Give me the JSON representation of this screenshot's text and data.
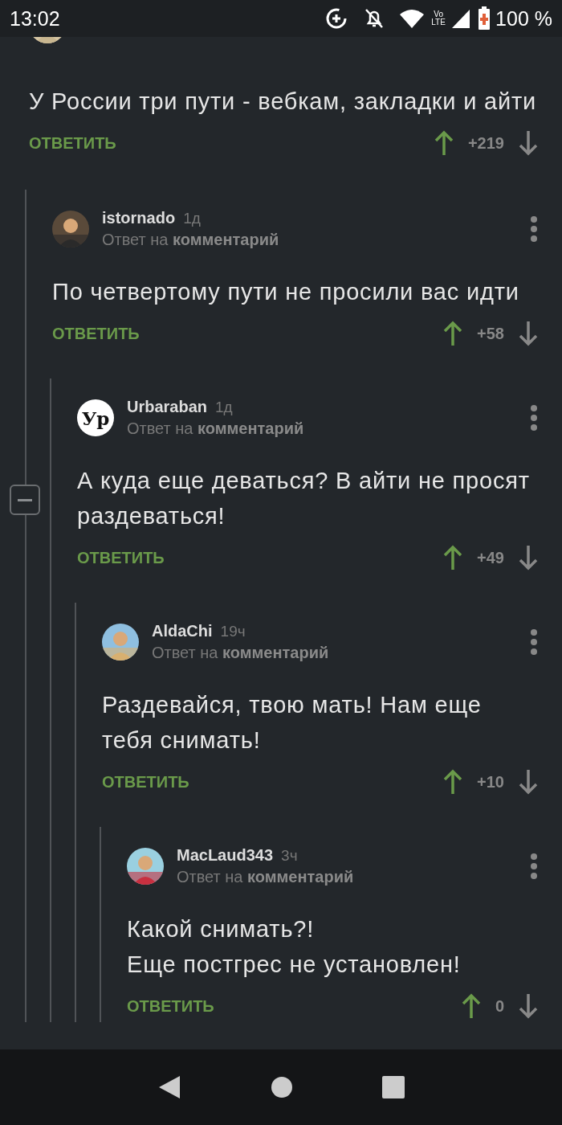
{
  "status_bar": {
    "time": "13:02",
    "network": "Vo LTE",
    "battery": "100 %"
  },
  "comments": [
    {
      "text": "У России три пути - вебкам, закладки и айти",
      "reply": "ОТВЕТИТЬ",
      "score": "+219",
      "children": [
        {
          "author": "istornado",
          "time": "1д",
          "subtitle": "Ответ на **комментарий**",
          "text": "По четвертому пути не просили вас идти",
          "reply": "ОТВЕТИТЬ",
          "score": "+58",
          "children": [
            {
              "author": "Urbaraban",
              "time": "1д",
              "subtitle": "Ответ на **комментарий**",
              "avatar": {
                "kind": "logo",
                "text": "Ур"
              },
              "collapse_button": true,
              "text": "А куда еще деваться? В айти не просят раздеваться!",
              "reply": "ОТВЕТИТЬ",
              "score": "+49",
              "children": [
                {
                  "author": "AldaChi",
                  "time": "19ч",
                  "subtitle": "Ответ на **комментарий**",
                  "text": "Раздевайся, твою мать! Нам еще тебя снимать!",
                  "reply": "ОТВЕТИТЬ",
                  "score": "+10",
                  "children": [
                    {
                      "author": "MacLaud343",
                      "time": "3ч",
                      "subtitle": "Ответ на **комментарий**",
                      "text": "Какой снимать?!\nЕще постгрес не установлен!",
                      "reply": "ОТВЕТИТЬ",
                      "score": "0"
                    }
                  ]
                }
              ]
            }
          ]
        }
      ]
    }
  ]
}
